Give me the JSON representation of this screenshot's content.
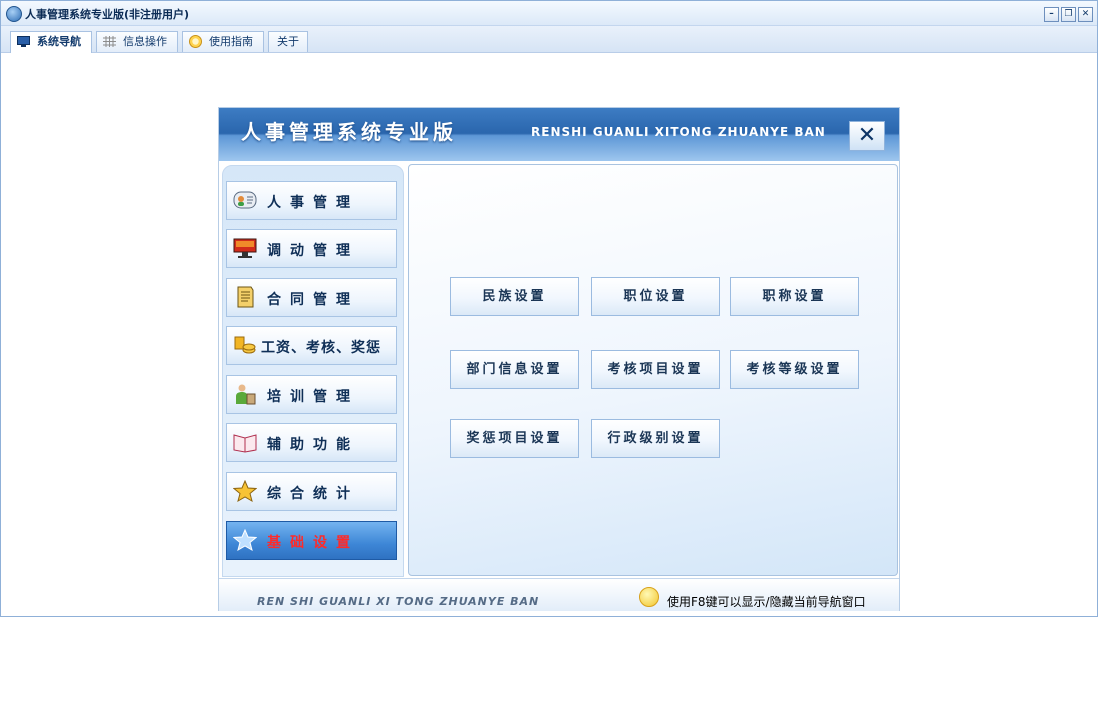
{
  "window": {
    "title": "人事管理系统专业版(非注册用户)",
    "controls": {
      "minimize": "–",
      "restore": "❐",
      "close": "✕"
    }
  },
  "tabs": [
    {
      "label": "系统导航",
      "icon": "monitor-icon",
      "active": true
    },
    {
      "label": "信息操作",
      "icon": "grid-icon",
      "active": false
    },
    {
      "label": "使用指南",
      "icon": "help-globe-icon",
      "active": false
    },
    {
      "label": "关于",
      "icon": "",
      "active": false
    }
  ],
  "nav": {
    "title": "人事管理系统专业版",
    "title_en": "RENSHI GUANLI XITONG ZHUANYE BAN",
    "close": "✕",
    "menu": [
      {
        "label": "人事管理",
        "icon": "contact-card-icon",
        "active": false
      },
      {
        "label": "调动管理",
        "icon": "monitor-icon",
        "active": false
      },
      {
        "label": "合同管理",
        "icon": "scroll-document-icon",
        "active": false
      },
      {
        "label": "工资、考核、奖惩",
        "icon": "coins-icon",
        "active": false
      },
      {
        "label": "培训管理",
        "icon": "people-icon",
        "active": false
      },
      {
        "label": "辅助功能",
        "icon": "book-icon",
        "active": false
      },
      {
        "label": "综合统计",
        "icon": "star-icon",
        "active": false
      },
      {
        "label": "基础设置",
        "icon": "star-outline-icon",
        "active": true
      }
    ],
    "settings": [
      "民族设置",
      "职位设置",
      "职称设置",
      "部门信息设置",
      "考核项目设置",
      "考核等级设置",
      "奖惩项目设置",
      "行政级别设置"
    ],
    "footer_en": "REN SHI GUANLI XI TONG ZHUANYE BAN",
    "footer_hint": "使用F8键可以显示/隐藏当前导航窗口"
  },
  "colors": {
    "accent": "#2a66ad",
    "active_menu_text": "#ff2a2a",
    "frame_border": "#8fb0d8"
  }
}
